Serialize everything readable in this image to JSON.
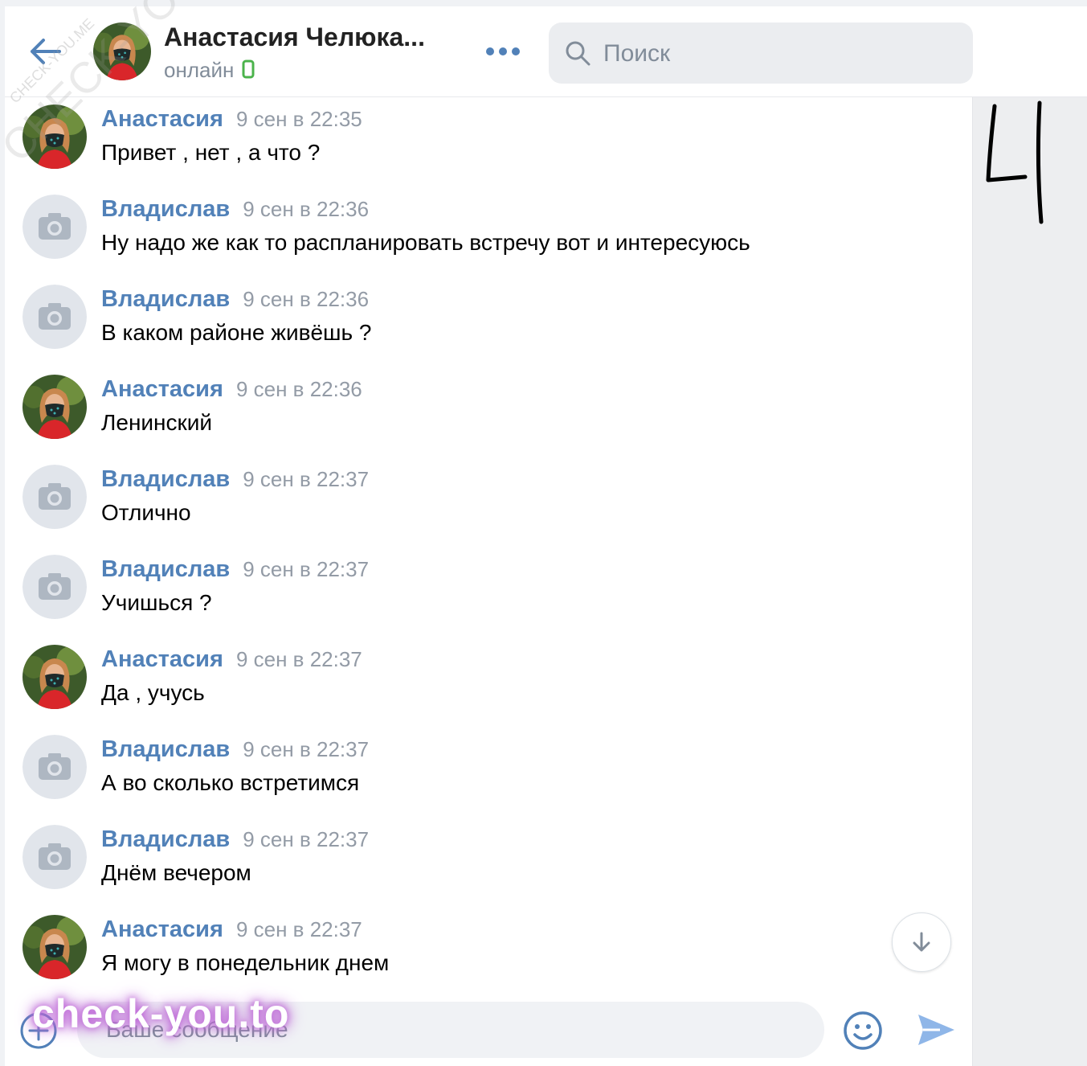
{
  "header": {
    "contact_name": "Анастасия Челюка...",
    "status": "онлайн",
    "search_placeholder": "Поиск"
  },
  "messages": [
    {
      "author": "Анастасия",
      "time": "9 сен в 22:35",
      "text": "Привет , нет , а что ?",
      "avatar": "photo"
    },
    {
      "author": "Владислав",
      "time": "9 сен в 22:36",
      "text": "Ну надо же как то распланировать встречу вот и интересуюсь",
      "avatar": "camera-placeholder"
    },
    {
      "author": "Владислав",
      "time": "9 сен в 22:36",
      "text": "В каком районе живёшь ?",
      "avatar": "camera-placeholder"
    },
    {
      "author": "Анастасия",
      "time": "9 сен в 22:36",
      "text": "Ленинский",
      "avatar": "photo"
    },
    {
      "author": "Владислав",
      "time": "9 сен в 22:37",
      "text": "Отлично",
      "avatar": "camera-placeholder"
    },
    {
      "author": "Владислав",
      "time": "9 сен в 22:37",
      "text": "Учишься ?",
      "avatar": "camera-placeholder"
    },
    {
      "author": "Анастасия",
      "time": "9 сен в 22:37",
      "text": "Да , учусь",
      "avatar": "photo"
    },
    {
      "author": "Владислав",
      "time": "9 сен в 22:37",
      "text": "А во сколько встретимся",
      "avatar": "camera-placeholder"
    },
    {
      "author": "Владислав",
      "time": "9 сен в 22:37",
      "text": "Днём вечером",
      "avatar": "camera-placeholder"
    },
    {
      "author": "Анастасия",
      "time": "9 сен в 22:37",
      "text": "Я могу в понедельник днем",
      "avatar": "photo"
    }
  ],
  "composer": {
    "placeholder": "Ваше сообщение"
  },
  "overlays": {
    "watermark_bottom": "check-you.to",
    "watermark_diagonal": "CHECK-YOU.ME",
    "watermark_small": "CHECK-YOU.ME",
    "handwritten_mark": "4"
  },
  "colors": {
    "accent": "#5181b8",
    "link": "#5181b8",
    "muted": "#939ba6",
    "online": "#4bb34b",
    "send": "#8fb6e8"
  },
  "icons": {
    "back": "arrow-left-icon",
    "more": "more-dots-icon",
    "search": "search-icon",
    "mobile": "mobile-online-icon",
    "scroll": "arrow-down-icon",
    "attach": "plus-circle-icon",
    "emoji": "smile-icon",
    "send": "send-icon"
  }
}
